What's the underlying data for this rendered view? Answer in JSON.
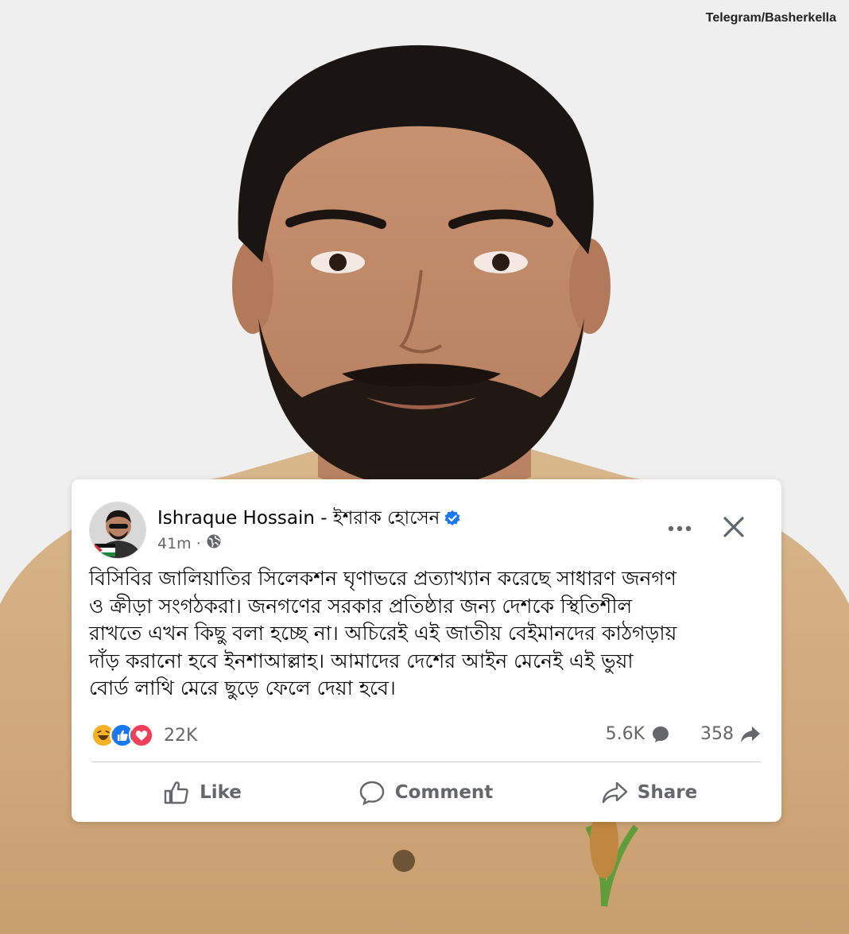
{
  "watermark": "Telegram/Basherkella",
  "post": {
    "author": "Ishraque Hossain - ইশরাক হোসেন",
    "time": "41m",
    "privacy_icon": "globe-icon",
    "text_lines": [
      "বিসিবির জালিয়াতির সিলেকশন ঘৃণাভরে প্রত্যাখ্যান করেছে সাধারণ জনগণ",
      "ও ক্রীড়া সংগঠকরা। জনগণের সরকার প্রতিষ্ঠার জন্য দেশকে স্থিতিশীল",
      "রাখতে এখন কিছু বলা হচ্ছে না।  অচিরেই এই জাতীয় বেইমানদের কাঠগড়ায়",
      "দাঁড় করানো হবে ইনশাআল্লাহ। আমাদের দেশের আইন মেনেই এই ভুয়া",
      "বোর্ড লাথি মেরে ছুড়ে ফেলে দেয়া হবে।"
    ],
    "reaction_count": "22K",
    "comment_count": "5.6K",
    "share_count": "358",
    "actions": {
      "like": "Like",
      "comment": "Comment",
      "share": "Share"
    }
  },
  "colors": {
    "verified": "#1877f2",
    "like": "#1877f2",
    "love": "#f33e58",
    "haha": "#f7b125",
    "secondary_text": "#65676b"
  }
}
